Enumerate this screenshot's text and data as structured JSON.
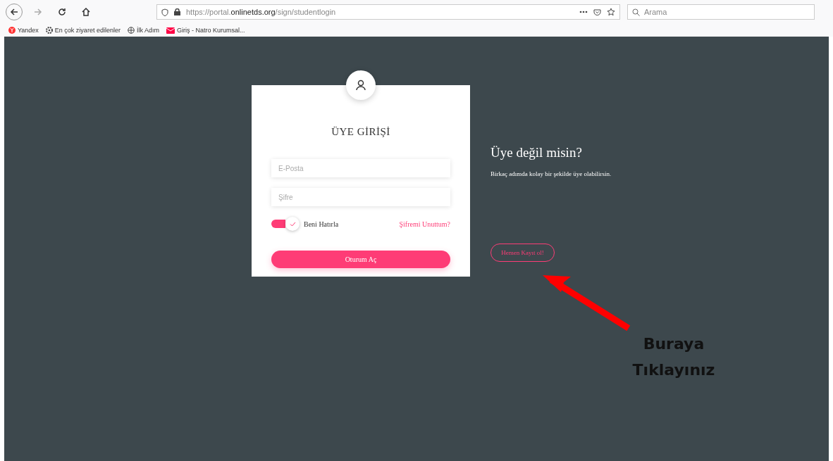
{
  "browser": {
    "url_prefix": "https://portal.",
    "url_domain": "onlinetds.org",
    "url_path": "/sign/studentlogin",
    "search_placeholder": "Arama",
    "bookmarks": [
      {
        "label": "Yandex",
        "kind": "yandex"
      },
      {
        "label": "En çok ziyaret edilenler",
        "kind": "gear"
      },
      {
        "label": "İlk Adım",
        "kind": "globe"
      },
      {
        "label": "Giriş - Natro Kurumsal...",
        "kind": "mail"
      }
    ]
  },
  "login": {
    "title": "ÜYE GİRİŞİ",
    "email_placeholder": "E-Posta",
    "password_placeholder": "Şifre",
    "remember": {
      "label": "Beni Hatırla",
      "on": true
    },
    "forgot": "Şifremi Unuttum?",
    "submit": "Oturum Aç"
  },
  "signup": {
    "title": "Üye değil misin?",
    "text": "Birkaç adımda kolay bir şekilde üye olabilirsin.",
    "button": "Hemen Kayıt ol!"
  },
  "annotation": {
    "lines": [
      "Buraya",
      "Tıklayınız"
    ]
  }
}
